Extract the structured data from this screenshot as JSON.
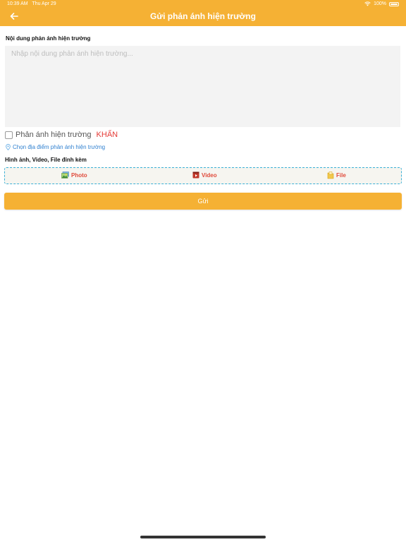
{
  "status_bar": {
    "time": "10:39 AM",
    "date": "Thu Apr 29",
    "battery": "100%"
  },
  "header": {
    "title": "Gửi phản ánh hiện trường",
    "background_color": "#f5b134"
  },
  "form": {
    "content_label": "Nội dung phản ánh hiện trường",
    "content_placeholder": "Nhập nội dung phản ánh hiện trường...",
    "content_value": "",
    "urgent_label": "Phản ánh hiện trường",
    "urgent_keyword": "KHẨN",
    "urgent_checked": false,
    "location_link": "Chọn địa điểm phản ánh hiện trường",
    "attachments_label": "Hình ảnh, Video, File đính kèm",
    "attachments": [
      {
        "label": "Photo",
        "icon": "photo-icon"
      },
      {
        "label": "Video",
        "icon": "video-icon"
      },
      {
        "label": "File",
        "icon": "file-icon"
      }
    ],
    "submit_label": "Gửi"
  },
  "colors": {
    "accent": "#f5b134",
    "urgent": "#e53935",
    "link": "#2f80d0",
    "attachment_text": "#e04a3a",
    "dashed_border": "#3bb0d6"
  }
}
